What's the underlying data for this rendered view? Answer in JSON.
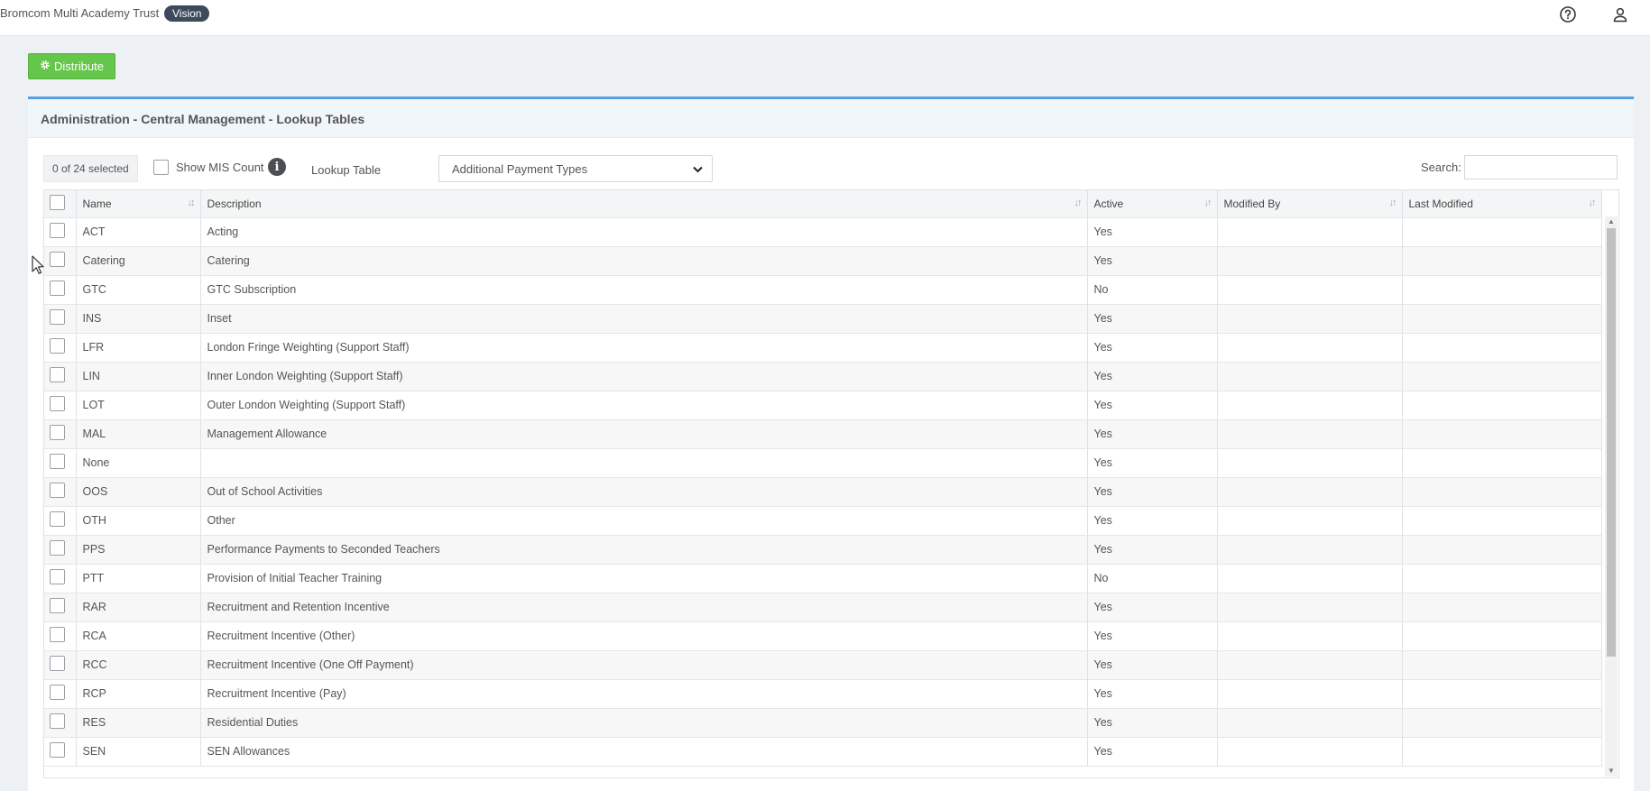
{
  "topbar": {
    "org_name": "Bromcom Multi Academy Trust",
    "badge": "Vision",
    "help_icon": "help-circle-icon",
    "user_icon": "user-icon"
  },
  "toolbar": {
    "distribute_label": "Distribute",
    "distribute_icon": "gear-icon",
    "accent": "#64c64a"
  },
  "panel": {
    "title": "Administration - Central Management - Lookup Tables",
    "accent": "#5aa0dc"
  },
  "controls": {
    "selected_count": "0 of 24 selected",
    "show_mis_label": "Show MIS Count",
    "lookup_label": "Lookup Table",
    "lookup_value": "Additional Payment Types",
    "search_label": "Search:",
    "search_value": ""
  },
  "table": {
    "headers": [
      "Name",
      "Description",
      "Active",
      "Modified By",
      "Last Modified"
    ],
    "rows": [
      {
        "name": "ACT",
        "description": "Acting",
        "active": "Yes",
        "modified_by": "",
        "last_modified": ""
      },
      {
        "name": "Catering",
        "description": "Catering",
        "active": "Yes",
        "modified_by": "",
        "last_modified": ""
      },
      {
        "name": "GTC",
        "description": "GTC Subscription",
        "active": "No",
        "modified_by": "",
        "last_modified": ""
      },
      {
        "name": "INS",
        "description": "Inset",
        "active": "Yes",
        "modified_by": "",
        "last_modified": ""
      },
      {
        "name": "LFR",
        "description": "London Fringe Weighting (Support Staff)",
        "active": "Yes",
        "modified_by": "",
        "last_modified": ""
      },
      {
        "name": "LIN",
        "description": "Inner London Weighting (Support Staff)",
        "active": "Yes",
        "modified_by": "",
        "last_modified": ""
      },
      {
        "name": "LOT",
        "description": "Outer London Weighting (Support Staff)",
        "active": "Yes",
        "modified_by": "",
        "last_modified": ""
      },
      {
        "name": "MAL",
        "description": "Management Allowance",
        "active": "Yes",
        "modified_by": "",
        "last_modified": ""
      },
      {
        "name": "None",
        "description": "",
        "active": "Yes",
        "modified_by": "",
        "last_modified": ""
      },
      {
        "name": "OOS",
        "description": "Out of School Activities",
        "active": "Yes",
        "modified_by": "",
        "last_modified": ""
      },
      {
        "name": "OTH",
        "description": "Other",
        "active": "Yes",
        "modified_by": "",
        "last_modified": ""
      },
      {
        "name": "PPS",
        "description": "Performance Payments to Seconded Teachers",
        "active": "Yes",
        "modified_by": "",
        "last_modified": ""
      },
      {
        "name": "PTT",
        "description": "Provision of Initial Teacher Training",
        "active": "No",
        "modified_by": "",
        "last_modified": ""
      },
      {
        "name": "RAR",
        "description": "Recruitment and Retention Incentive",
        "active": "Yes",
        "modified_by": "",
        "last_modified": ""
      },
      {
        "name": "RCA",
        "description": "Recruitment Incentive (Other)",
        "active": "Yes",
        "modified_by": "",
        "last_modified": ""
      },
      {
        "name": "RCC",
        "description": "Recruitment Incentive (One Off Payment)",
        "active": "Yes",
        "modified_by": "",
        "last_modified": ""
      },
      {
        "name": "RCP",
        "description": "Recruitment Incentive (Pay)",
        "active": "Yes",
        "modified_by": "",
        "last_modified": ""
      },
      {
        "name": "RES",
        "description": "Residential Duties",
        "active": "Yes",
        "modified_by": "",
        "last_modified": ""
      },
      {
        "name": "SEN",
        "description": "SEN Allowances",
        "active": "Yes",
        "modified_by": "",
        "last_modified": ""
      }
    ]
  }
}
